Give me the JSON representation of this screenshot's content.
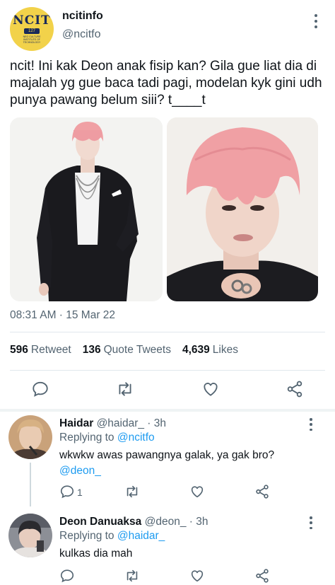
{
  "tweet": {
    "display_name": "ncitinfo",
    "handle": "@ncitfo",
    "avatar_logo": "NCIT",
    "avatar_badge": "127",
    "avatar_subtext": "NEO CULTURE INSTITUTE OF TECHNOLOGY",
    "text": "ncit! Ini kak Deon anak fisip kan? Gila gue liat dia di majalah yg gue baca tadi pagi, modelan kyk gini udh punya pawang belum siii? t____t",
    "timestamp": "08:31 AM · 15 Mar 22",
    "retweets": "596",
    "retweets_label": "Retweet",
    "quotes": "136",
    "quotes_label": "Quote Tweets",
    "likes": "4,639",
    "likes_label": "Likes",
    "photos": [
      "photo-full-body",
      "photo-portrait"
    ]
  },
  "colors": {
    "accent": "#1d9bf0",
    "secondary_text": "#536471",
    "hair_pink": "#f0a0a4",
    "suit_black": "#1a1a1e"
  },
  "actions": {
    "icons": [
      "reply-icon",
      "retweet-icon",
      "like-icon",
      "share-icon"
    ]
  },
  "replies": [
    {
      "name": "Haidar",
      "meta": "@haidar_ · 3h",
      "replying_prefix": "Replying to",
      "replying_to": "@ncitfo",
      "text": "wkwkw awas pawangnya galak, ya gak bro?",
      "mention": "@deon_",
      "reply_count": "1"
    },
    {
      "name": "Deon Danuaksa",
      "meta": "@deon_ · 3h",
      "replying_prefix": "Replying to",
      "replying_to": "@haidar_",
      "text": "kulkas dia mah",
      "mention": "",
      "reply_count": ""
    }
  ]
}
